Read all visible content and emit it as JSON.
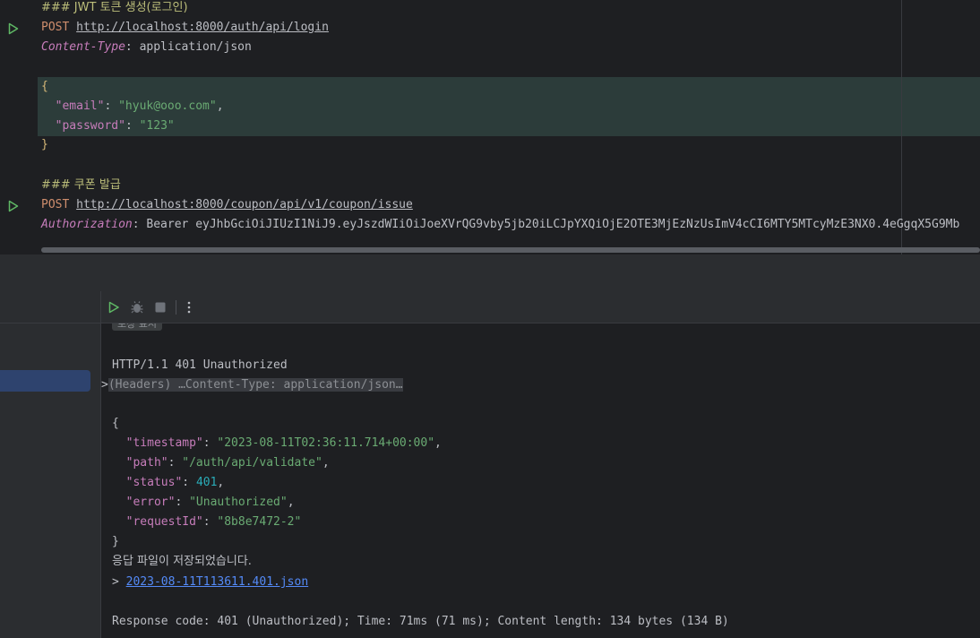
{
  "editor": {
    "request1": {
      "comment": "### JWT 토큰 생성(로그인)",
      "method": "POST",
      "url": "http://localhost:8000/auth/api/login",
      "header_name": "Content-Type",
      "header_sep": ": ",
      "header_value": "application/json",
      "open_brace": "{",
      "close_brace": "}",
      "email_key": "\"email\"",
      "email_value": "\"hyuk@ooo.com\"",
      "password_key": "\"password\"",
      "password_value": "\"123\""
    },
    "request2": {
      "comment": "### 쿠폰 발급",
      "method": "POST",
      "url": "http://localhost:8000/coupon/api/v1/coupon/issue",
      "header_name": "Authorization",
      "header_sep": ": ",
      "header_value": "Bearer eyJhbGciOiJIUzI1NiJ9.eyJszdWIiOiJoeXVrQG9vby5jb20iLCJpYXQiOjE2OTE3MjEzNzUsImV4cCI6MTY5MTcyMzE3NX0.4eGgqX5G9Mb"
    }
  },
  "response": {
    "chip": "보상 표시",
    "status_line": "HTTP/1.1 401 Unauthorized",
    "fold_arrow": ">",
    "headers_fold": "(Headers) …Content-Type: application/json…",
    "open_brace": "{",
    "close_brace": "}",
    "fields": {
      "timestamp_key": "\"timestamp\"",
      "timestamp_value": "\"2023-08-11T02:36:11.714+00:00\"",
      "path_key": "\"path\"",
      "path_value": "\"/auth/api/validate\"",
      "status_key": "\"status\"",
      "status_value": "401",
      "error_key": "\"error\"",
      "error_value": "\"Unauthorized\"",
      "requestId_key": "\"requestId\"",
      "requestId_value": "\"8b8e7472-2\""
    },
    "saved_message": "응답 파일이 저장되었습니다.",
    "file_prefix": "> ",
    "file_link": "2023-08-11T113611.401.json",
    "summary": "Response code: 401 (Unauthorized); Time: 71ms (71 ms); Content length: 134 bytes (134 B)"
  },
  "toolbar": {
    "icons": [
      "run-icon",
      "debug-icon",
      "stop-icon",
      "more-options-icon"
    ]
  }
}
